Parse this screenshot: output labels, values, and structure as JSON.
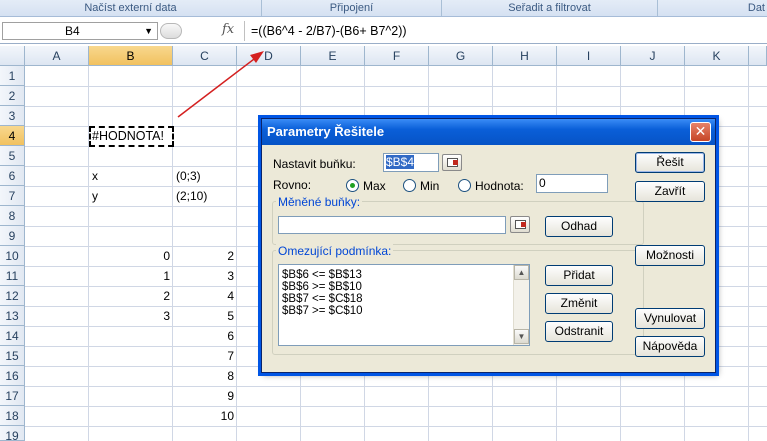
{
  "ribbon": {
    "groups": [
      {
        "label": "Načíst externí data"
      },
      {
        "label": "Připojení"
      },
      {
        "label": "Seřadit a filtrovat"
      },
      {
        "label": "Dat"
      }
    ]
  },
  "formula_bar": {
    "name_box": "B4",
    "fx_symbol": "fx",
    "formula": "=((B6^4 - 2/B7)-(B6+ B7^2))"
  },
  "columns": [
    "A",
    "B",
    "C",
    "D",
    "E",
    "F",
    "G",
    "H",
    "I",
    "J",
    "K"
  ],
  "rows": [
    "1",
    "2",
    "3",
    "4",
    "5",
    "6",
    "7",
    "8",
    "9",
    "10",
    "11",
    "12",
    "13",
    "14",
    "15",
    "16",
    "17",
    "18",
    "19"
  ],
  "cells": {
    "B4": "#HODNOTA!",
    "B6": "x",
    "C6": "(0;3)",
    "B7": "y",
    "C7": "(2;10)",
    "B10": "0",
    "C10": "2",
    "B11": "1",
    "C11": "3",
    "B12": "2",
    "C12": "4",
    "B13": "3",
    "C13": "5",
    "C14": "6",
    "C15": "7",
    "C16": "8",
    "C17": "9",
    "C18": "10"
  },
  "accent_arrow_color": "#d42020",
  "dialog": {
    "title": "Parametry Řešitele",
    "close_symbol": "✕",
    "set_cell_label": "Nastavit buňku:",
    "set_cell_value": "$B$4",
    "equal_to_label": "Rovno:",
    "radio_max": "Max",
    "radio_min": "Min",
    "radio_value": "Hodnota:",
    "value_field": "0",
    "changing_cells_label": "Měněné buňky:",
    "changing_cells_value": "",
    "guess_button": "Odhad",
    "constraints_label": "Omezující podmínka:",
    "constraints": [
      "$B$6 <= $B$13",
      "$B$6 >= $B$10",
      "$B$7 <= $C$18",
      "$B$7 >= $C$10"
    ],
    "add_button": "Přidat",
    "change_button": "Změnit",
    "delete_button": "Odstranit",
    "solve_button": "Řešit",
    "close_button": "Zavřít",
    "options_button": "Možnosti",
    "reset_button": "Vynulovat",
    "help_button": "Nápověda"
  }
}
